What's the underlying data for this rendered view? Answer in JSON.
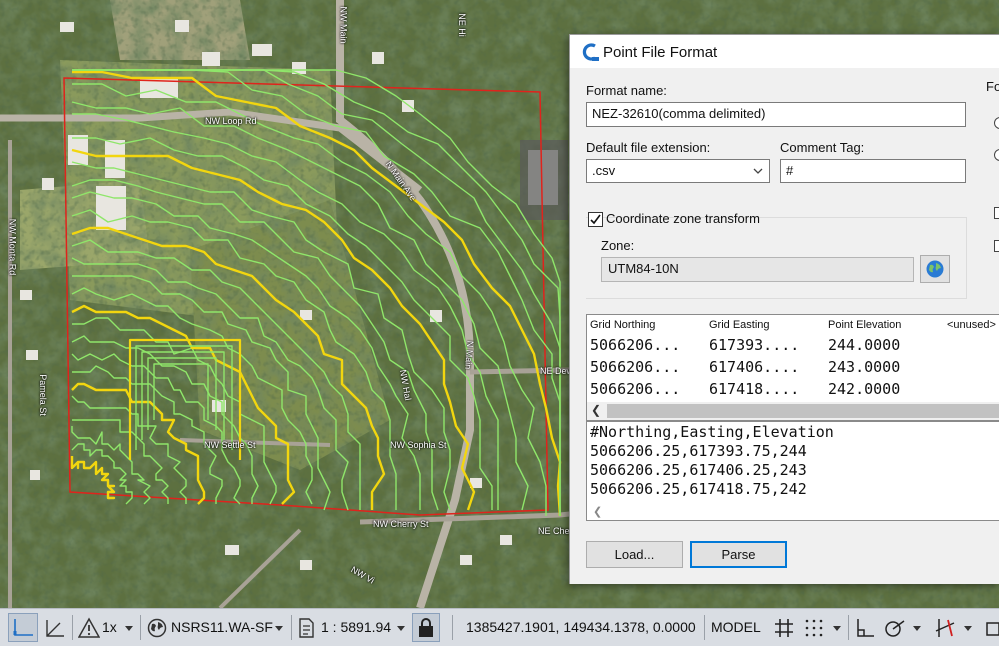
{
  "map": {
    "streets": [
      "NW Loop Rd",
      "N Main Ave",
      "NW Settle St",
      "NW Sophia St",
      "NW Cherry St",
      "NE Dew",
      "NE Chest",
      "NW Monta Rd",
      "Pamela St",
      "NW Main",
      "NW Hal",
      "NE Hi",
      "NW Vi",
      "N Main"
    ]
  },
  "dialog": {
    "title": "Point File Format",
    "format_name_label": "Format name:",
    "format_name_value": "NEZ-32610(comma delimited)",
    "default_ext_label": "Default file extension:",
    "default_ext_value": ".csv",
    "comment_tag_label": "Comment Tag:",
    "comment_tag_value": "#",
    "coord_zone_label": "Coordinate zone transform",
    "coord_zone_checked": true,
    "zone_label": "Zone:",
    "zone_value": "UTM84-10N",
    "right_partial_label": "Fo",
    "table": {
      "columns": [
        "Grid Northing",
        "Grid Easting",
        "Point Elevation",
        "<unused>"
      ],
      "rows": [
        [
          "5066206...",
          "617393....",
          "244.0000"
        ],
        [
          "5066206...",
          "617406....",
          "243.0000"
        ],
        [
          "5066206...",
          "617418....",
          "242.0000"
        ]
      ]
    },
    "preview_lines": [
      "#Northing,Easting,Elevation",
      "5066206.25,617393.75,244",
      "5066206.25,617406.25,243",
      "5066206.25,617418.75,242"
    ],
    "load_button": "Load...",
    "parse_button": "Parse"
  },
  "statusbar": {
    "scale_factor": "1x",
    "coord_system": "NSRS11.WA-SF",
    "annotation_scale": "1 : 5891.94",
    "coordinates": "1385427.1901, 149434.1378, 0.0000",
    "space": "MODEL"
  },
  "colors": {
    "contour_major": "#f2d60f",
    "contour_minor": "#8fe66a",
    "boundary": "#e0231c",
    "accent": "#0078d7"
  }
}
